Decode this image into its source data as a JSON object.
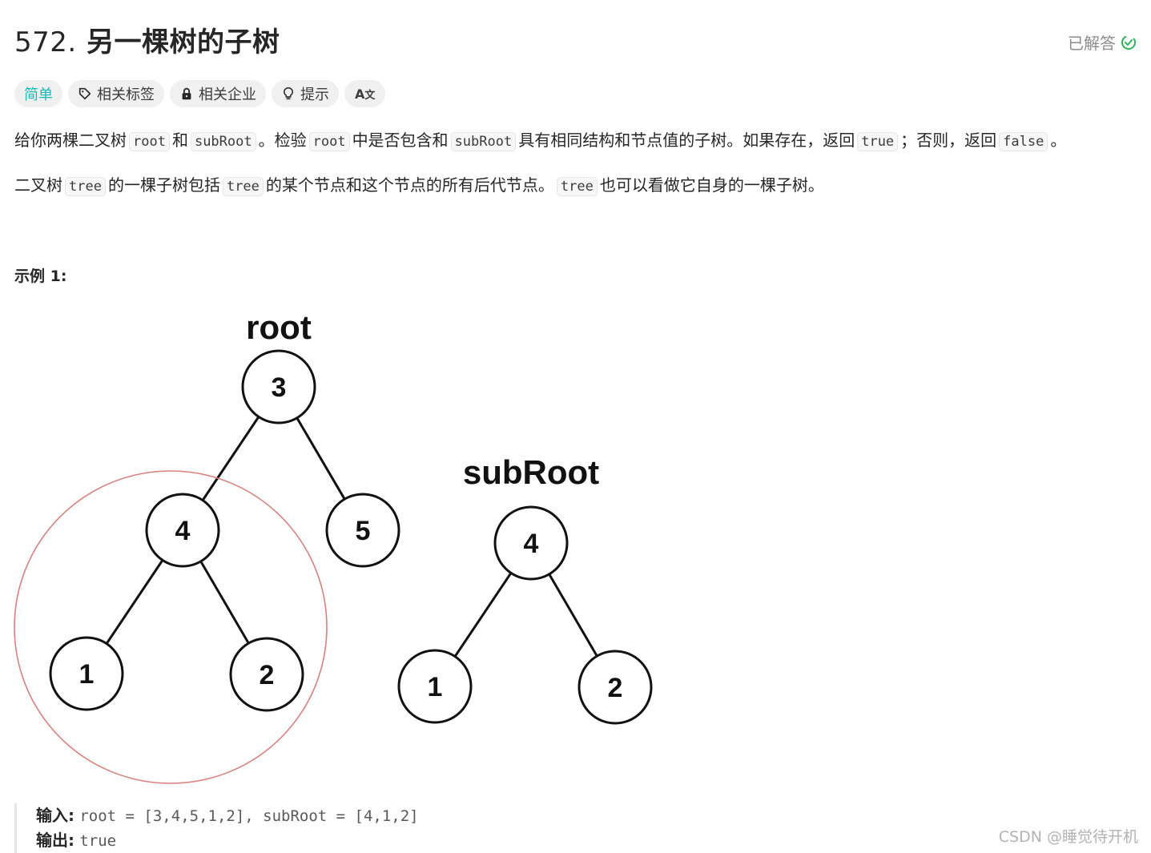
{
  "problem": {
    "number": "572.",
    "title": "另一棵树的子树",
    "status": "已解答",
    "status_color": "#2db55d"
  },
  "tags": {
    "difficulty": "简单",
    "difficulty_color": "#1cb8b8",
    "related_tags": "相关标签",
    "related_companies": "相关企业",
    "hint": "提示",
    "translate": "Aあ"
  },
  "description": {
    "p1": [
      {
        "t": "text",
        "v": "给你两棵二叉树"
      },
      {
        "t": "code",
        "v": "root"
      },
      {
        "t": "text",
        "v": "和"
      },
      {
        "t": "code",
        "v": "subRoot"
      },
      {
        "t": "text",
        "v": "。检验"
      },
      {
        "t": "code",
        "v": "root"
      },
      {
        "t": "text",
        "v": "中是否包含和"
      },
      {
        "t": "code",
        "v": "subRoot"
      },
      {
        "t": "text",
        "v": "具有相同结构和节点值的子树。如果存在，返回"
      },
      {
        "t": "code",
        "v": "true"
      },
      {
        "t": "text",
        "v": "；否则，返回"
      },
      {
        "t": "code",
        "v": "false"
      },
      {
        "t": "text",
        "v": "。"
      }
    ],
    "p2": [
      {
        "t": "text",
        "v": "二叉树"
      },
      {
        "t": "code",
        "v": "tree"
      },
      {
        "t": "text",
        "v": "的一棵子树包括"
      },
      {
        "t": "code",
        "v": "tree"
      },
      {
        "t": "text",
        "v": "的某个节点和这个节点的所有后代节点。"
      },
      {
        "t": "code",
        "v": "tree"
      },
      {
        "t": "text",
        "v": "也可以看做它自身的一棵子树。"
      }
    ]
  },
  "example": {
    "title": "示例 1:",
    "diagram": {
      "root_label": "root",
      "subroot_label": "subRoot",
      "root_tree": {
        "nodes": [
          {
            "id": "r3",
            "value": "3"
          },
          {
            "id": "r4",
            "value": "4"
          },
          {
            "id": "r5",
            "value": "5"
          },
          {
            "id": "r1",
            "value": "1"
          },
          {
            "id": "r2",
            "value": "2"
          }
        ],
        "edges": [
          [
            "r3",
            "r4"
          ],
          [
            "r3",
            "r5"
          ],
          [
            "r4",
            "r1"
          ],
          [
            "r4",
            "r2"
          ]
        ],
        "highlighted_subtree_root": "r4",
        "highlight_color": "#d9817e"
      },
      "subroot_tree": {
        "nodes": [
          {
            "id": "s4",
            "value": "4"
          },
          {
            "id": "s1",
            "value": "1"
          },
          {
            "id": "s2",
            "value": "2"
          }
        ],
        "edges": [
          [
            "s4",
            "s1"
          ],
          [
            "s4",
            "s2"
          ]
        ]
      }
    },
    "input_label": "输入:",
    "input_value": "root = [3,4,5,1,2], subRoot = [4,1,2]",
    "output_label": "输出:",
    "output_value": "true"
  },
  "watermark": "CSDN @睡觉待开机"
}
